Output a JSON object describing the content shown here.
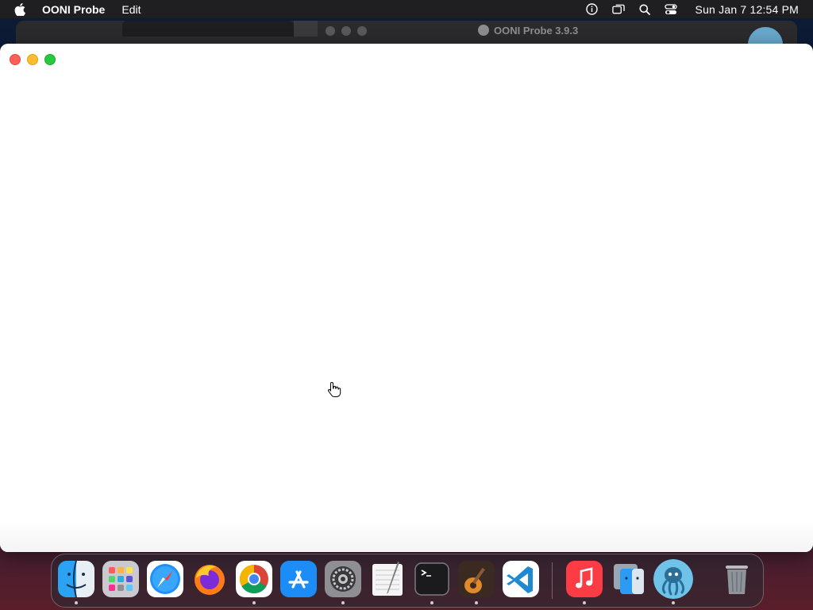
{
  "menubar": {
    "app_name": "OONI Probe",
    "menus": [
      "Edit"
    ],
    "clock": "Sun Jan 7  12:54 PM",
    "status_icons": [
      "info-icon",
      "screen-mirroring-icon",
      "spotlight-search-icon",
      "control-center-icon"
    ]
  },
  "background_window": {
    "title": "OONI Probe 3.9.3"
  },
  "main_window": {
    "traffic_lights": [
      "close",
      "minimize",
      "zoom"
    ],
    "content": ""
  },
  "dock": {
    "items": [
      {
        "name": "Finder",
        "icon": "finder-icon",
        "running": true
      },
      {
        "name": "Launchpad",
        "icon": "launchpad-icon",
        "running": false
      },
      {
        "name": "Safari",
        "icon": "safari-icon",
        "running": false
      },
      {
        "name": "Firefox",
        "icon": "firefox-icon",
        "running": false
      },
      {
        "name": "Google Chrome",
        "icon": "chrome-icon",
        "running": true
      },
      {
        "name": "App Store",
        "icon": "app-store-icon",
        "running": false
      },
      {
        "name": "System Settings",
        "icon": "system-settings-icon",
        "running": true
      },
      {
        "name": "TextEdit",
        "icon": "textedit-icon",
        "running": false
      },
      {
        "name": "Terminal",
        "icon": "terminal-icon",
        "running": true
      },
      {
        "name": "GarageBand",
        "icon": "garageband-icon",
        "running": true
      },
      {
        "name": "Visual Studio Code",
        "icon": "vscode-icon",
        "running": false
      },
      {
        "name": "Music",
        "icon": "music-icon",
        "running": true
      },
      {
        "name": "Migration Assistant",
        "icon": "migration-assistant-icon",
        "running": false
      },
      {
        "name": "OONI Probe",
        "icon": "ooni-probe-icon",
        "running": true
      },
      {
        "name": "Trash",
        "icon": "trash-icon",
        "running": false
      }
    ]
  }
}
